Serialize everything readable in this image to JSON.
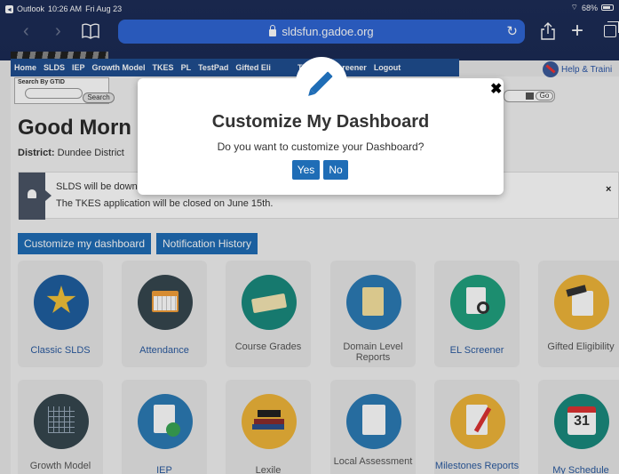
{
  "status_bar": {
    "app": "Outlook",
    "time": "10:26 AM",
    "date": "Fri Aug 23",
    "battery": "68%"
  },
  "browser": {
    "url": "sldsfun.gadoe.org"
  },
  "nav": {
    "items": [
      "Home",
      "SLDS",
      "IEP",
      "Growth Model",
      "TKES",
      "PL",
      "TestPad",
      "Gifted Eli",
      "TRL",
      "EL Screener",
      "Logout"
    ],
    "help": "Help & Traini"
  },
  "search": {
    "label": "Search By GTID",
    "button": "Search",
    "go": "Go"
  },
  "page": {
    "greeting": "Good Morn",
    "district_label": "District:",
    "district_value": "Dundee District"
  },
  "notice": {
    "line1": "SLDS will be down",
    "line2": "The TKES application will be closed on June 15th.",
    "close": "×"
  },
  "actions": {
    "customize": "Customize my dashboard",
    "history": "Notification History"
  },
  "tiles_row1": [
    {
      "label": "Classic SLDS",
      "icon": "star-icon"
    },
    {
      "label": "Attendance",
      "icon": "calendar-icon"
    },
    {
      "label": "Course Grades",
      "icon": "book-icon"
    },
    {
      "label": "Domain Level Reports",
      "icon": "notepad-icon"
    },
    {
      "label": "EL Screener",
      "icon": "document-magnifier-icon"
    },
    {
      "label": "Gifted Eligibility",
      "icon": "graduation-cap-icon"
    }
  ],
  "tiles_row2": [
    {
      "label": "Growth Model",
      "icon": "grid-chart-icon"
    },
    {
      "label": "IEP",
      "icon": "checklist-icon"
    },
    {
      "label": "Lexile",
      "icon": "books-icon"
    },
    {
      "label": "Local Assessment",
      "icon": "checkbox-list-icon"
    },
    {
      "label": "Milestones Reports",
      "icon": "pencil-checklist-icon"
    },
    {
      "label": "My Schedule",
      "icon": "calendar-31-icon",
      "day": "31"
    }
  ],
  "modal": {
    "title": "Customize My Dashboard",
    "question": "Do you want to customize your Dashboard?",
    "yes": "Yes",
    "no": "No",
    "close": "✖"
  }
}
